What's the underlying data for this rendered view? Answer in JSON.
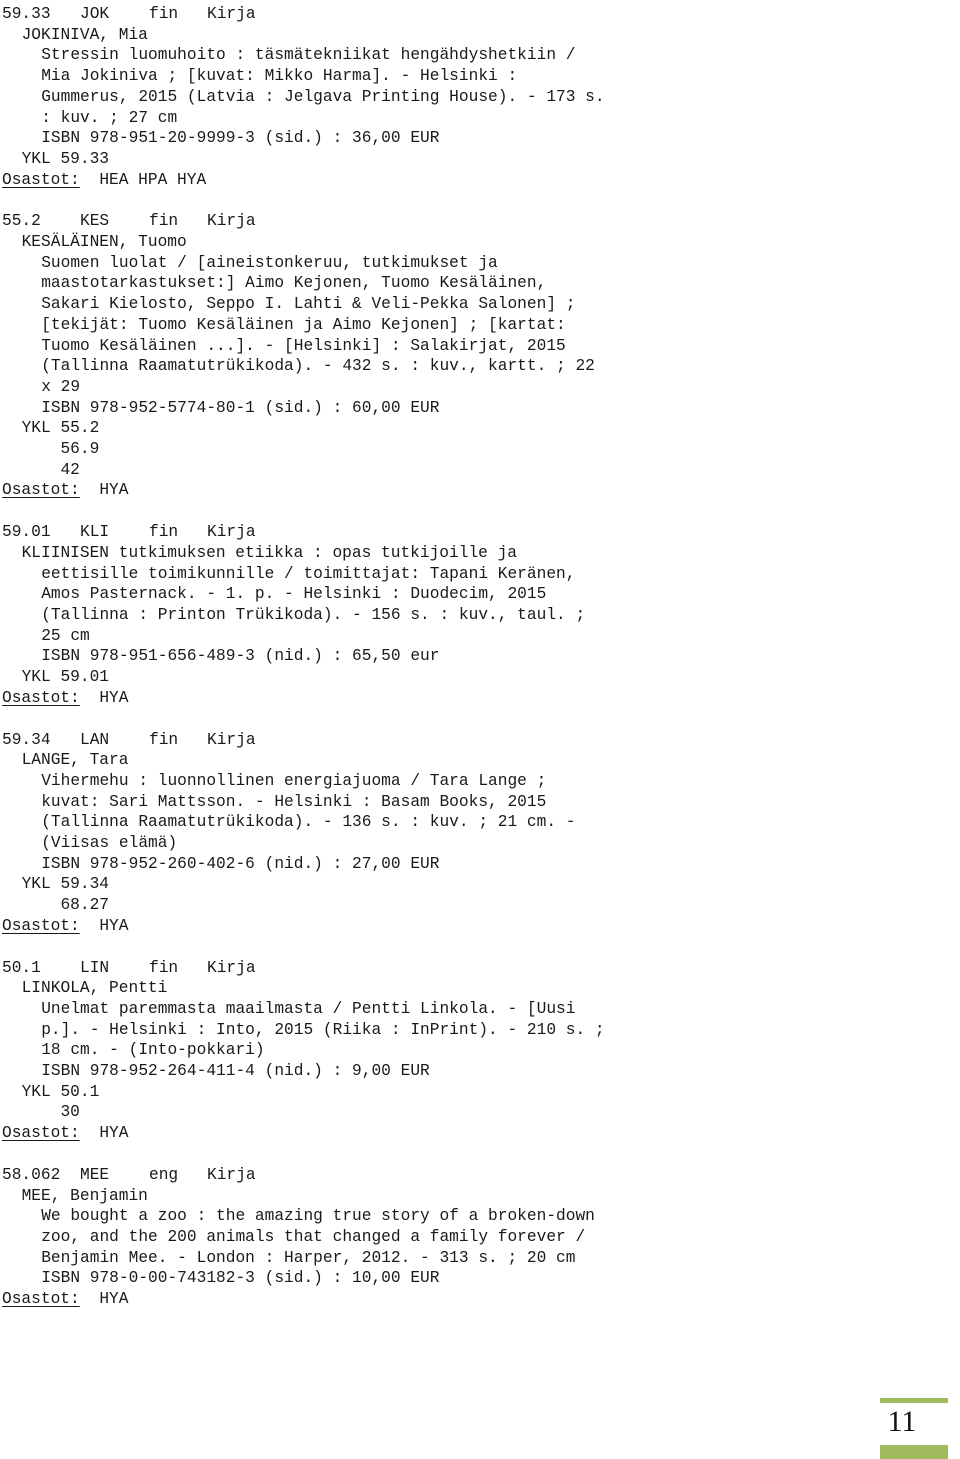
{
  "document": {
    "kind": "library-catalogue-listing",
    "labels": {
      "osastot": "Osastot:",
      "ykl_prefix": "YKL"
    },
    "colors": {
      "accent_green": "#9fbb5e",
      "text": "#1a1a1a",
      "background": "#ffffff"
    }
  },
  "records": [
    {
      "header": {
        "classification": "59.33",
        "cutter": "JOK",
        "language": "fin",
        "material": "Kirja"
      },
      "author": "JOKINIVA, Mia",
      "body": [
        "Stressin luomuhoito : täsmätekniikat hengähdyshetkiin /",
        "Mia Jokiniva ; [kuvat: Mikko Harma]. - Helsinki :",
        "Gummerus, 2015 (Latvia : Jelgava Printing House). - 173 s.",
        ": kuv. ; 27 cm",
        "ISBN 978-951-20-9999-3 (sid.) : 36,00 EUR"
      ],
      "ykl": [
        "YKL 59.33"
      ],
      "osastot": "HEA HPA HYA"
    },
    {
      "header": {
        "classification": "55.2",
        "cutter": "KES",
        "language": "fin",
        "material": "Kirja"
      },
      "author": "KESÄLÄINEN, Tuomo",
      "body": [
        "Suomen luolat / [aineistonkeruu, tutkimukset ja",
        "maastotarkastukset:] Aimo Kejonen, Tuomo Kesäläinen,",
        "Sakari Kielosto, Seppo I. Lahti & Veli-Pekka Salonen] ;",
        "[tekijät: Tuomo Kesäläinen ja Aimo Kejonen] ; [kartat:",
        "Tuomo Kesäläinen ...]. - [Helsinki] : Salakirjat, 2015",
        "(Tallinna Raamatutrükikoda). - 432 s. : kuv., kartt. ; 22",
        "x 29",
        "ISBN 978-952-5774-80-1 (sid.) : 60,00 EUR"
      ],
      "ykl": [
        "YKL 55.2",
        "    56.9",
        "    42"
      ],
      "osastot": "HYA"
    },
    {
      "header": {
        "classification": "59.01",
        "cutter": "KLI",
        "language": "fin",
        "material": "Kirja"
      },
      "author": "KLIINISEN tutkimuksen etiikka : opas tutkijoille ja",
      "body": [
        "eettisille toimikunnille / toimittajat: Tapani Keränen,",
        "Amos Pasternack. - 1. p. - Helsinki : Duodecim, 2015",
        "(Tallinna : Printon Trükikoda). - 156 s. : kuv., taul. ;",
        "25 cm",
        "ISBN 978-951-656-489-3 (nid.) : 65,50 eur"
      ],
      "ykl": [
        "YKL 59.01"
      ],
      "osastot": "HYA"
    },
    {
      "header": {
        "classification": "59.34",
        "cutter": "LAN",
        "language": "fin",
        "material": "Kirja"
      },
      "author": "LANGE, Tara",
      "body": [
        "Vihermehu : luonnollinen energiajuoma / Tara Lange ;",
        "kuvat: Sari Mattsson. - Helsinki : Basam Books, 2015",
        "(Tallinna Raamatutrükikoda). - 136 s. : kuv. ; 21 cm. -",
        "(Viisas elämä)",
        "ISBN 978-952-260-402-6 (nid.) : 27,00 EUR"
      ],
      "ykl": [
        "YKL 59.34",
        "    68.27"
      ],
      "osastot": "HYA"
    },
    {
      "header": {
        "classification": "50.1",
        "cutter": "LIN",
        "language": "fin",
        "material": "Kirja"
      },
      "author": "LINKOLA, Pentti",
      "body": [
        "Unelmat paremmasta maailmasta / Pentti Linkola. - [Uusi",
        "p.]. - Helsinki : Into, 2015 (Riika : InPrint). - 210 s. ;",
        "18 cm. - (Into-pokkari)",
        "ISBN 978-952-264-411-4 (nid.) : 9,00 EUR"
      ],
      "ykl": [
        "YKL 50.1",
        "    30"
      ],
      "osastot": "HYA"
    },
    {
      "header": {
        "classification": "58.062",
        "cutter": "MEE",
        "language": "eng",
        "material": "Kirja"
      },
      "author": "MEE, Benjamin",
      "body": [
        "We bought a zoo : the amazing true story of a broken-down",
        "zoo, and the 200 animals that changed a family forever /",
        "Benjamin Mee. - London : Harper, 2012. - 313 s. ; 20 cm",
        "ISBN 978-0-00-743182-3 (sid.) : 10,00 EUR"
      ],
      "ykl": [],
      "osastot": "HYA"
    }
  ],
  "footer": {
    "page_number": "11"
  }
}
